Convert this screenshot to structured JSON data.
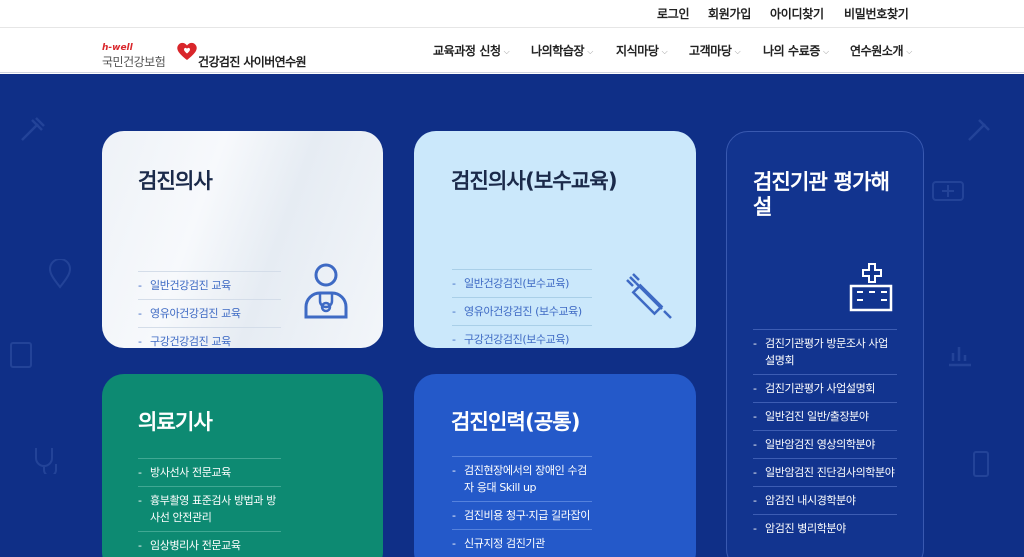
{
  "util_nav": [
    {
      "label": "로그인"
    },
    {
      "label": "회원가입"
    },
    {
      "label": "아이디찾기"
    },
    {
      "label": "비밀번호찾기"
    }
  ],
  "logo": {
    "hwell": "h-well",
    "nhis": "국민건강보험",
    "subtitle": "건강검진 사이버연수원"
  },
  "gnb": [
    {
      "label": "교육과정 신청"
    },
    {
      "label": "나의학습장"
    },
    {
      "label": "지식마당"
    },
    {
      "label": "고객마당"
    },
    {
      "label": "나의 수료증"
    },
    {
      "label": "연수원소개"
    }
  ],
  "cards": [
    {
      "title": "검진의사",
      "icon": "doctor-icon",
      "items": [
        "일반건강검진 교육",
        "영유아건강검진 교육",
        "구강건강검진 교육"
      ]
    },
    {
      "title": "검진의사(보수교육)",
      "icon": "syringe-icon",
      "items": [
        "일반건강검진(보수교육)",
        "영유아건강검진 (보수교육)",
        "구강건강검진(보수교육)"
      ]
    },
    {
      "title": "검진기관 평가해설",
      "icon": "hospital-icon",
      "items": [
        "검진기관평가 방문조사 사업설명회",
        "검진기관평가 사업설명회",
        "일반검진 일반/출장분야",
        "일반암검진 영상의학분야",
        "일반암검진 진단검사의학분야",
        "암검진 내시경학분야",
        "암검진 병리학분야"
      ]
    },
    {
      "title": "의료기사",
      "items": [
        "방사선사 전문교육",
        "흉부촬영 표준검사 방법과 방사선 안전관리",
        "임상병리사 전문교육"
      ]
    },
    {
      "title": "검진인력(공통)",
      "items": [
        "검진현장에서의 장애인 수검자 응대 Skill up",
        "검진비용 청구·지급 길라잡이",
        "신규지정 검진기관"
      ]
    }
  ],
  "colors": {
    "main_bg": "#0f2f87",
    "card_green": "#0d8a72",
    "card_blue": "#2459c9",
    "card_light": "#cbe8fb",
    "brand_red": "#d9262b"
  }
}
